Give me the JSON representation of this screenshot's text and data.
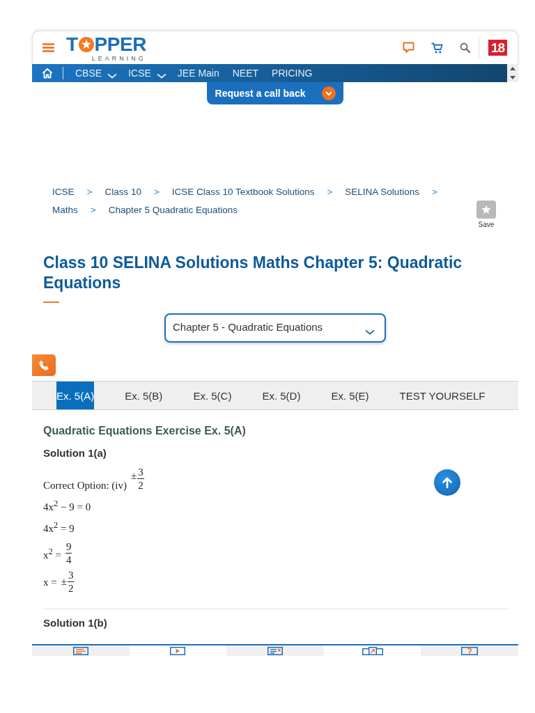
{
  "header": {
    "logo": {
      "word_start": "T",
      "word_end": "PPER",
      "tagline": "LEARNING"
    },
    "partner_badge": "18"
  },
  "nav": {
    "items": [
      {
        "label": "CBSE",
        "has_dropdown": true
      },
      {
        "label": "ICSE",
        "has_dropdown": true
      },
      {
        "label": "JEE Main",
        "has_dropdown": false
      },
      {
        "label": "NEET",
        "has_dropdown": false
      },
      {
        "label": "PRICING",
        "has_dropdown": false
      }
    ]
  },
  "callback_button": {
    "label": "Request a call back"
  },
  "breadcrumb": [
    {
      "label": "ICSE",
      "separator": ">"
    },
    {
      "label": "Class 10",
      "separator": ">"
    },
    {
      "label": "ICSE Class 10 Textbook Solutions",
      "separator": ">"
    },
    {
      "label": "SELINA Solutions",
      "separator": ">"
    },
    {
      "label": "Maths",
      "separator": ">"
    },
    {
      "label": "Chapter 5 Quadratic Equations"
    }
  ],
  "save": {
    "label": "Save"
  },
  "title": "Class 10 SELINA Solutions Maths Chapter 5: Quadratic Equations",
  "chapter_select": {
    "value": "Chapter 5 - Quadratic Equations"
  },
  "tabs": [
    {
      "label": "Ex. 5(A)",
      "selected": true
    },
    {
      "label": "Ex. 5(B)",
      "selected": false
    },
    {
      "label": "Ex. 5(C)",
      "selected": false
    },
    {
      "label": "Ex. 5(D)",
      "selected": false
    },
    {
      "label": "Ex. 5(E)",
      "selected": false
    },
    {
      "label": "TEST YOURSELF",
      "selected": false
    }
  ],
  "content": {
    "heading": "Quadratic Equations Exercise Ex. 5(A)",
    "solutions": [
      {
        "title": "Solution 1(a)",
        "lines": [
          {
            "kind": "raised-fraction",
            "prefix": "Correct Option: (iv)",
            "sign": "±",
            "numerator": "3",
            "denominator": "2"
          },
          {
            "kind": "text",
            "text": "4x$^{2}$ − 9 = 0"
          },
          {
            "kind": "text",
            "text": "4x$^{2}$ = 9"
          },
          {
            "kind": "fraction",
            "prefix": "x$^{2}$ =",
            "numerator": "9",
            "denominator": "4"
          },
          {
            "kind": "fraction",
            "prefix": "x =",
            "sign": "±",
            "numerator": "3",
            "denominator": "2"
          }
        ]
      },
      {
        "title": "Solution 1(b)"
      }
    ]
  }
}
